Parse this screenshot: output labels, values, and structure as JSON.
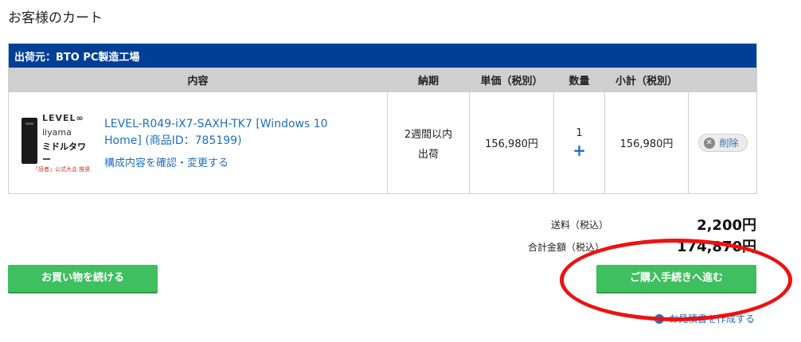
{
  "page": {
    "title": "お客様のカート"
  },
  "cart": {
    "shipper_label": "出荷元：BTO PC製造工場",
    "columns": [
      "内容",
      "納期",
      "単価（税別）",
      "数量",
      "小計（税別）",
      ""
    ],
    "items": [
      {
        "name": "LEVEL-R049-iX7-SAXH-TK7 [Windows 10 Home] (商品ID：785199)",
        "config_link": "構成内容を確認・変更する",
        "delivery": "2週間以内出荷",
        "delivery_line1": "2週間以内",
        "delivery_line2": "出荷",
        "unit_price": "156,980円",
        "quantity": "1",
        "quantity_plus": "+",
        "subtotal": "156,980円",
        "delete_label": "削除",
        "thumb": {
          "brand": "LEVEL∞",
          "maker": "iiyama",
          "model": "ミドルタワー",
          "caption": "「読者」公式大会 推奨"
        }
      }
    ]
  },
  "summary": {
    "shipping_label": "送料（税込）",
    "shipping_value": "2,200円",
    "total_label": "合計金額（税込）",
    "total_value": "174,870円"
  },
  "actions": {
    "continue_label": "お買い物を続ける",
    "checkout_label": "ご購入手続きへ進む",
    "quote_label": "お見積書を作成する"
  },
  "colors": {
    "header_blue": "#003f97",
    "button_green": "#3fbf5f",
    "link_blue": "#1f6fbd",
    "annotation_red": "#ee1111"
  },
  "icons": {
    "delete": "x-circle-icon",
    "quote": "arrow-circle-icon",
    "plus": "plus-icon"
  }
}
